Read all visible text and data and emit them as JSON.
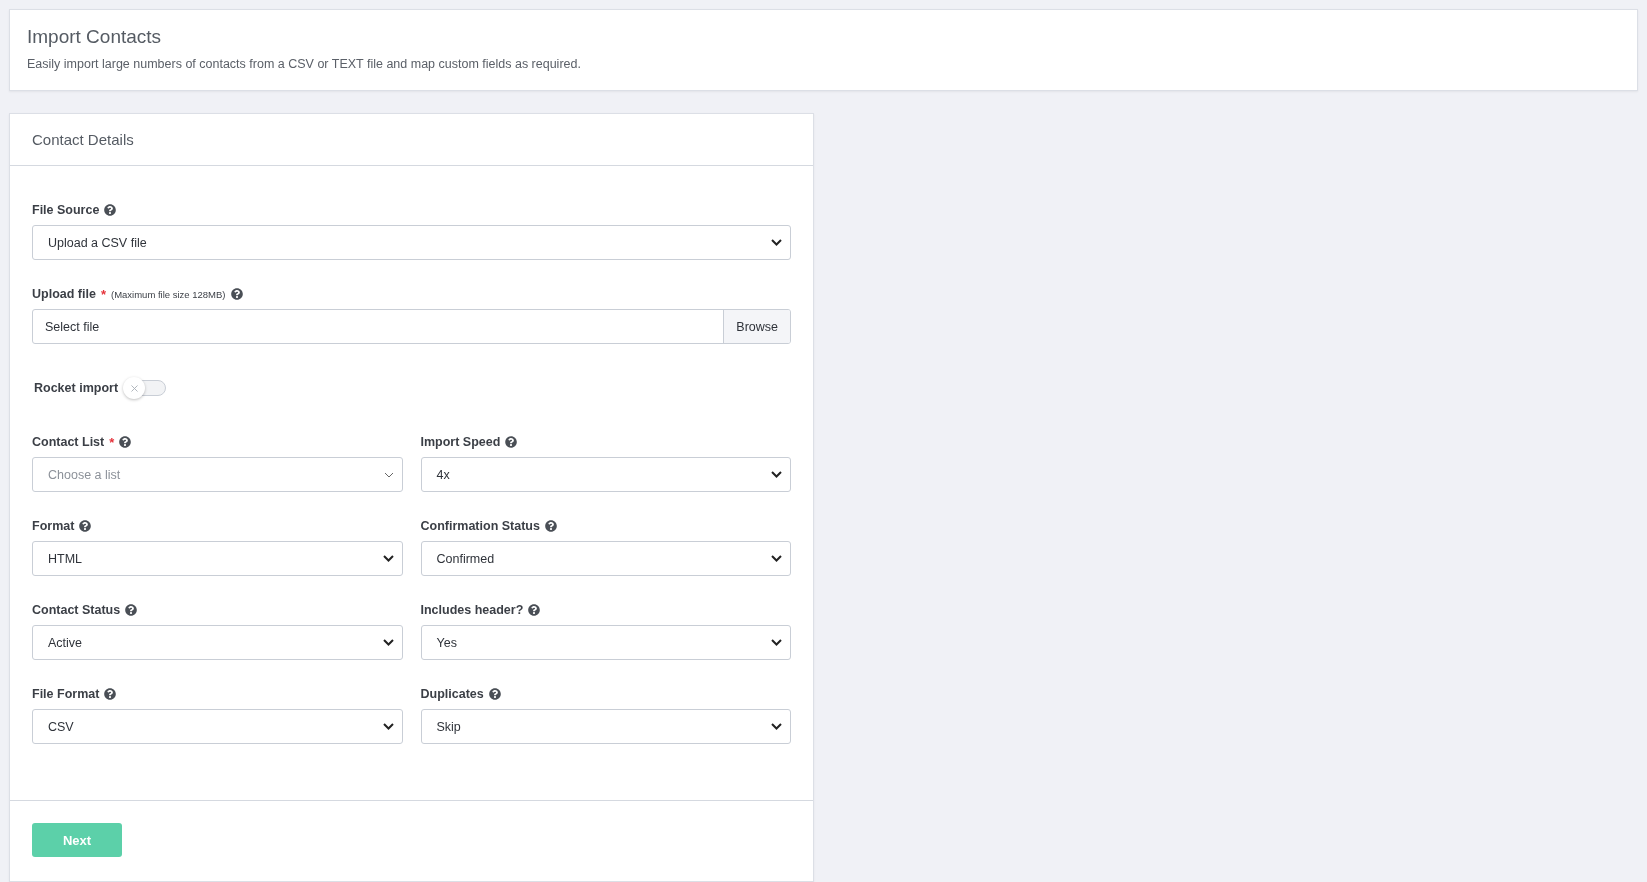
{
  "page_header": {
    "title": "Import Contacts",
    "description": "Easily import large numbers of contacts from a CSV or TEXT file and map custom fields as required."
  },
  "card": {
    "title": "Contact Details",
    "wide_fields": [
      {
        "kind": "select",
        "label": "File Source",
        "value": "Upload a CSV file"
      },
      {
        "kind": "file",
        "label": "Upload file",
        "required_mark": "*",
        "note": "(Maximum file size 128MB)",
        "placeholder": "Select file",
        "button": "Browse"
      },
      {
        "kind": "toggle",
        "label": "Rocket import",
        "on": false
      }
    ],
    "grid_fields": [
      {
        "kind": "combo",
        "label": "Contact List",
        "required_mark": "*",
        "placeholder": "Choose a list"
      },
      {
        "kind": "select",
        "label": "Import Speed",
        "value": "4x"
      },
      {
        "kind": "select",
        "label": "Format",
        "value": "HTML"
      },
      {
        "kind": "select",
        "label": "Confirmation Status",
        "value": "Confirmed"
      },
      {
        "kind": "select",
        "label": "Contact Status",
        "value": "Active"
      },
      {
        "kind": "select",
        "label": "Includes header?",
        "value": "Yes"
      },
      {
        "kind": "select",
        "label": "File Format",
        "value": "CSV"
      },
      {
        "kind": "select",
        "label": "Duplicates",
        "value": "Skip"
      }
    ],
    "submit": "Next"
  }
}
